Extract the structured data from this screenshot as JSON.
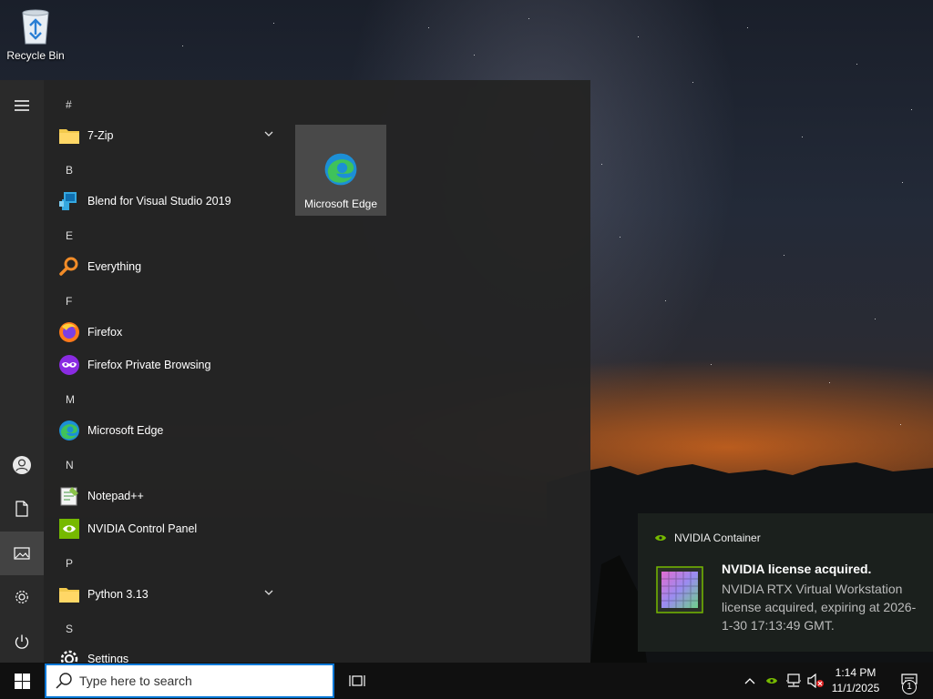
{
  "desktop": {
    "icons": [
      {
        "label": "Recycle Bin",
        "icon": "recycle-bin-icon"
      }
    ]
  },
  "start_menu": {
    "rail": [
      "hamburger-icon",
      "user-icon",
      "document-icon",
      "pictures-icon",
      "settings-icon",
      "power-icon"
    ],
    "app_list": [
      {
        "type": "letter",
        "text": "#"
      },
      {
        "type": "app",
        "label": "7-Zip",
        "icon": "folder-icon",
        "expandable": true
      },
      {
        "type": "letter",
        "text": "B"
      },
      {
        "type": "app",
        "label": "Blend for Visual Studio 2019",
        "icon": "blend-icon"
      },
      {
        "type": "letter",
        "text": "E"
      },
      {
        "type": "app",
        "label": "Everything",
        "icon": "magnifier-icon"
      },
      {
        "type": "letter",
        "text": "F"
      },
      {
        "type": "app",
        "label": "Firefox",
        "icon": "firefox-icon"
      },
      {
        "type": "app",
        "label": "Firefox Private Browsing",
        "icon": "firefox-private-icon"
      },
      {
        "type": "letter",
        "text": "M"
      },
      {
        "type": "app",
        "label": "Microsoft Edge",
        "icon": "edge-icon"
      },
      {
        "type": "letter",
        "text": "N"
      },
      {
        "type": "app",
        "label": "Notepad++",
        "icon": "notepadpp-icon"
      },
      {
        "type": "app",
        "label": "NVIDIA Control Panel",
        "icon": "nvidia-icon"
      },
      {
        "type": "letter",
        "text": "P"
      },
      {
        "type": "app",
        "label": "Python 3.13",
        "icon": "folder-icon",
        "expandable": true
      },
      {
        "type": "letter",
        "text": "S"
      },
      {
        "type": "app",
        "label": "Settings",
        "icon": "gear-icon"
      }
    ],
    "tiles": [
      {
        "label": "Microsoft Edge",
        "icon": "edge-icon"
      }
    ]
  },
  "notification": {
    "app_name": "NVIDIA Container",
    "title": "NVIDIA license acquired.",
    "body": "NVIDIA RTX Virtual Workstation license acquired, expiring at 2026-1-30 17:13:49 GMT."
  },
  "taskbar": {
    "search_placeholder": "Type here to search",
    "clock_time": "1:14 PM",
    "clock_date": "11/1/2025",
    "notification_count": "1"
  }
}
